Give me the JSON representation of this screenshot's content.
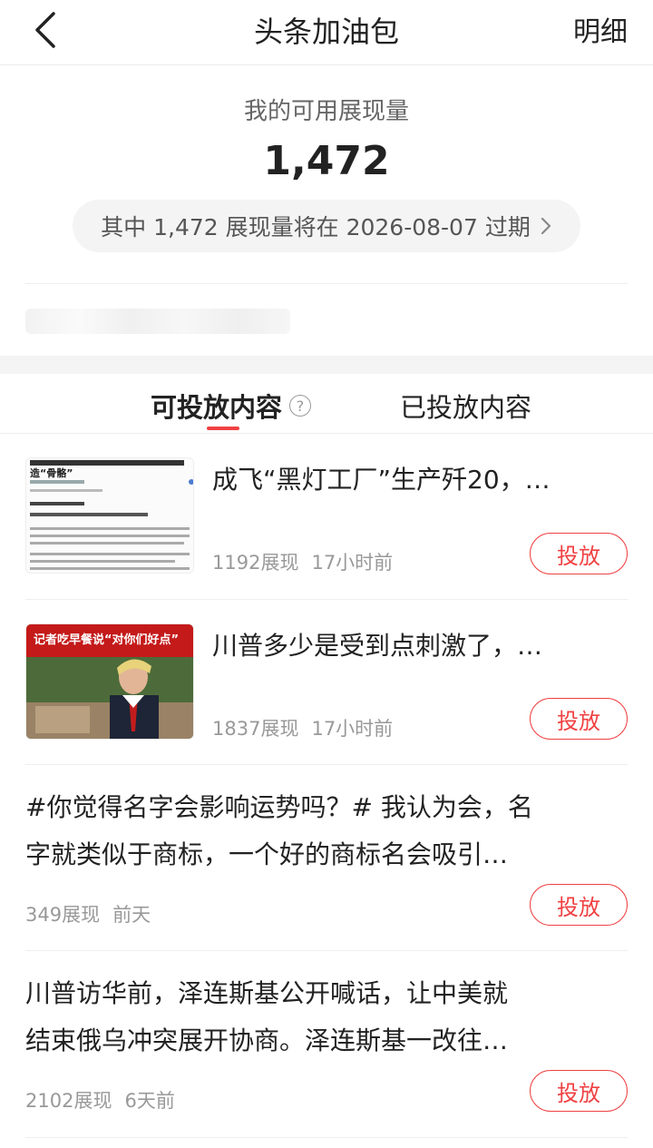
{
  "header": {
    "title": "头条加油包",
    "detail_label": "明细"
  },
  "summary": {
    "label": "我的可用展现量",
    "value": "1,472",
    "expire_text": "其中 1,472 展现量将在 2026-08-07 过期"
  },
  "tabs": {
    "available": "可投放内容",
    "placed": "已投放内容",
    "help": "?"
  },
  "items": [
    {
      "title": "成飞“黑灯工厂”生产歼20，…",
      "views": "1192展现",
      "time": "17小时前",
      "button": "投放",
      "thumb_caption": "造“骨骼”"
    },
    {
      "title": "川普多少是受到点刺激了，…",
      "views": "1837展现",
      "time": "17小时前",
      "button": "投放",
      "thumb_caption": "记者吃早餐说“对你们好点”"
    },
    {
      "title_line1": "#你觉得名字会影响运势吗？# 我认为会，名",
      "title_line2": "字就类似于商标，一个好的商标名会吸引…",
      "views": "349展现",
      "time": "前天",
      "button": "投放"
    },
    {
      "title_line1": "川普访华前，泽连斯基公开喊话，让中美就",
      "title_line2": "结束俄乌冲突展开协商。泽连斯基一改往…",
      "views": "2102展现",
      "time": "6天前",
      "button": "投放"
    }
  ],
  "colors": {
    "accent": "#f04142",
    "muted": "#999999",
    "pill_bg": "#f4f4f4"
  }
}
